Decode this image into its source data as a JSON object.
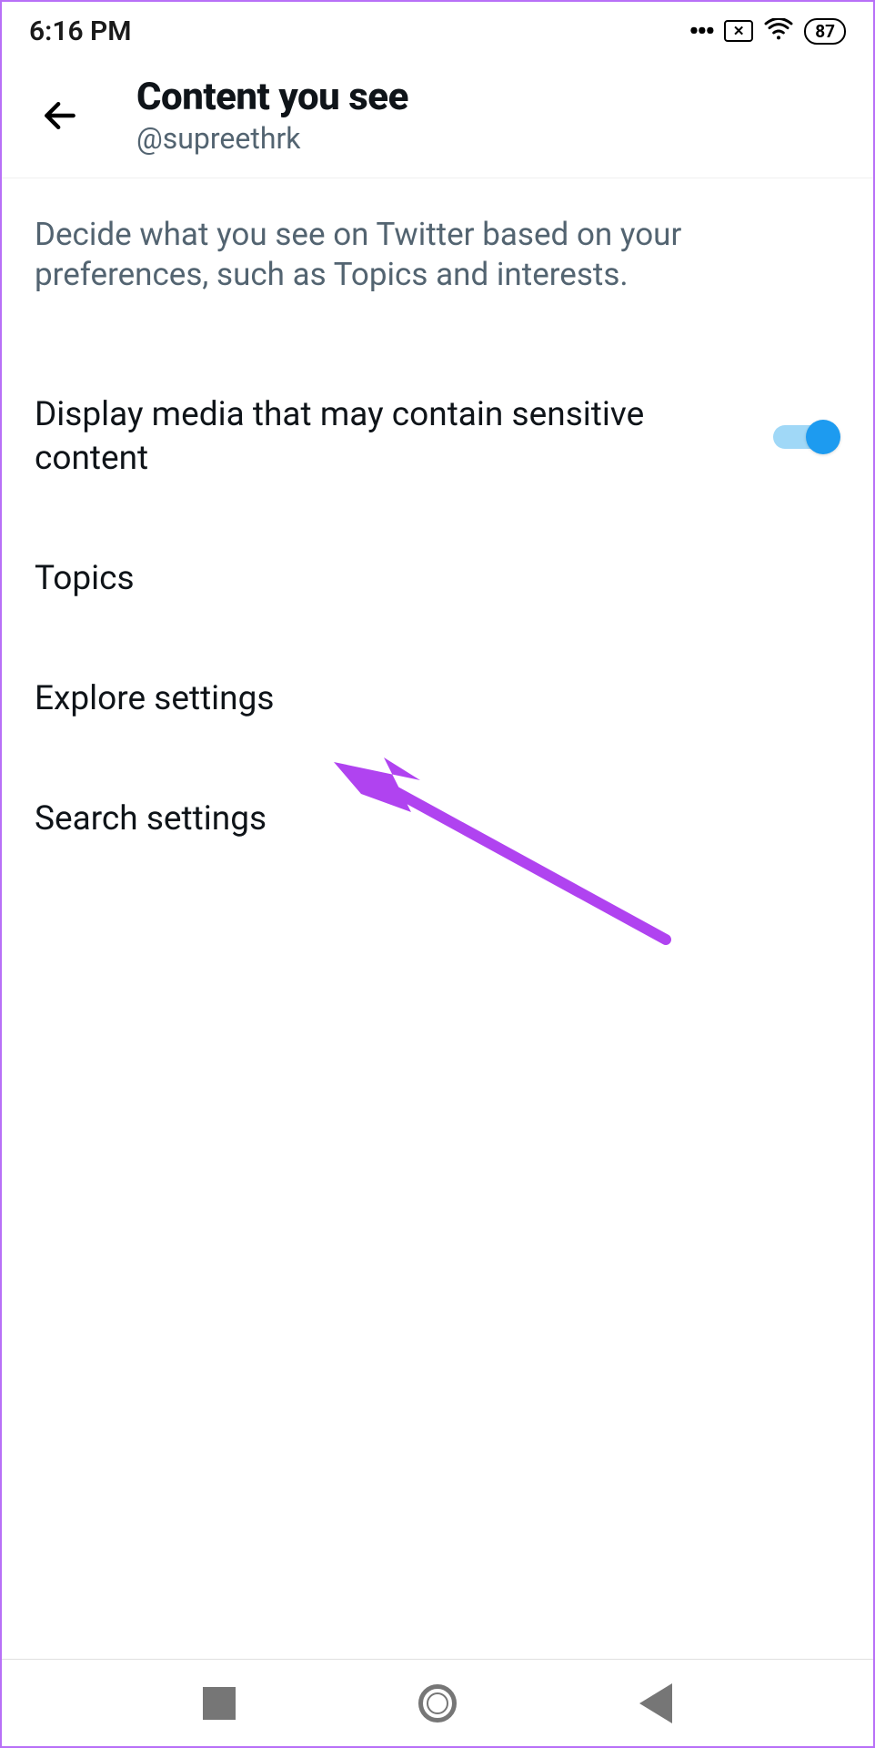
{
  "statusBar": {
    "time": "6:16 PM",
    "batteryLevel": "87"
  },
  "header": {
    "title": "Content you see",
    "username": "@supreethrk"
  },
  "content": {
    "description": "Decide what you see on Twitter based on your preferences, such as Topics and interests.",
    "items": {
      "sensitiveMedia": {
        "label": "Display media that may contain sensitive content",
        "toggled": true
      },
      "topics": {
        "label": "Topics"
      },
      "explore": {
        "label": "Explore settings"
      },
      "search": {
        "label": "Search settings"
      }
    }
  }
}
